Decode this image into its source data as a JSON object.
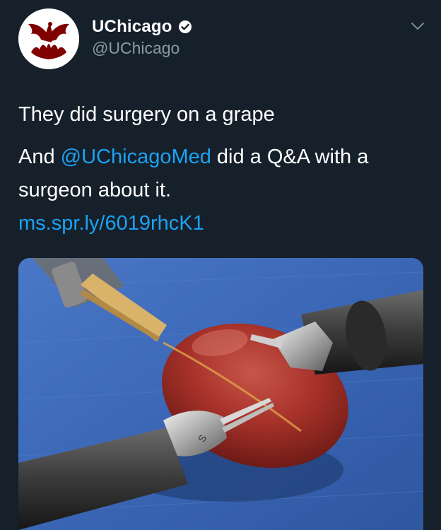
{
  "account": {
    "display_name": "UChicago",
    "handle": "@UChicago",
    "verified": true
  },
  "tweet": {
    "line1": "They did surgery on a grape",
    "para2": {
      "prefix": "And ",
      "mention": "@UChicagoMed",
      "middle": " did a Q&A with a surgeon about it. ",
      "link": "ms.spr.ly/6019rhcK1"
    }
  },
  "media": {
    "description_icon": "photo",
    "instrument_label": "S"
  },
  "colors": {
    "background": "#15202b",
    "text": "#ffffff",
    "secondary": "#8899a6",
    "link": "#1da1f2",
    "brand_maroon": "#800000"
  },
  "icons": {
    "verified": "verified-badge-icon",
    "more": "chevron-down-icon"
  }
}
